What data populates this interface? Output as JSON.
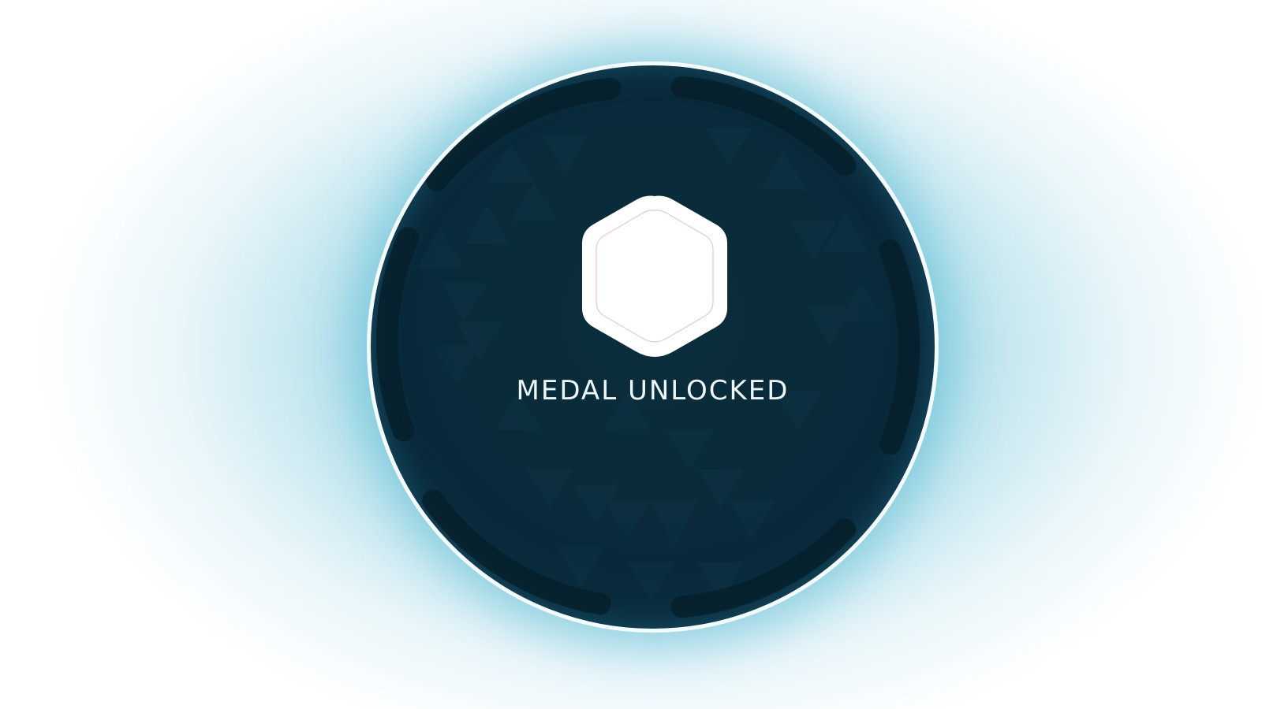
{
  "notification": {
    "title": "MEDAL UNLOCKED",
    "badge_icon": "hexagon-medal-icon"
  },
  "colors": {
    "disc": "#0a2c3a",
    "glow": "#6fc3d9",
    "text": "#eef6f8",
    "badge": "#ffffff"
  }
}
